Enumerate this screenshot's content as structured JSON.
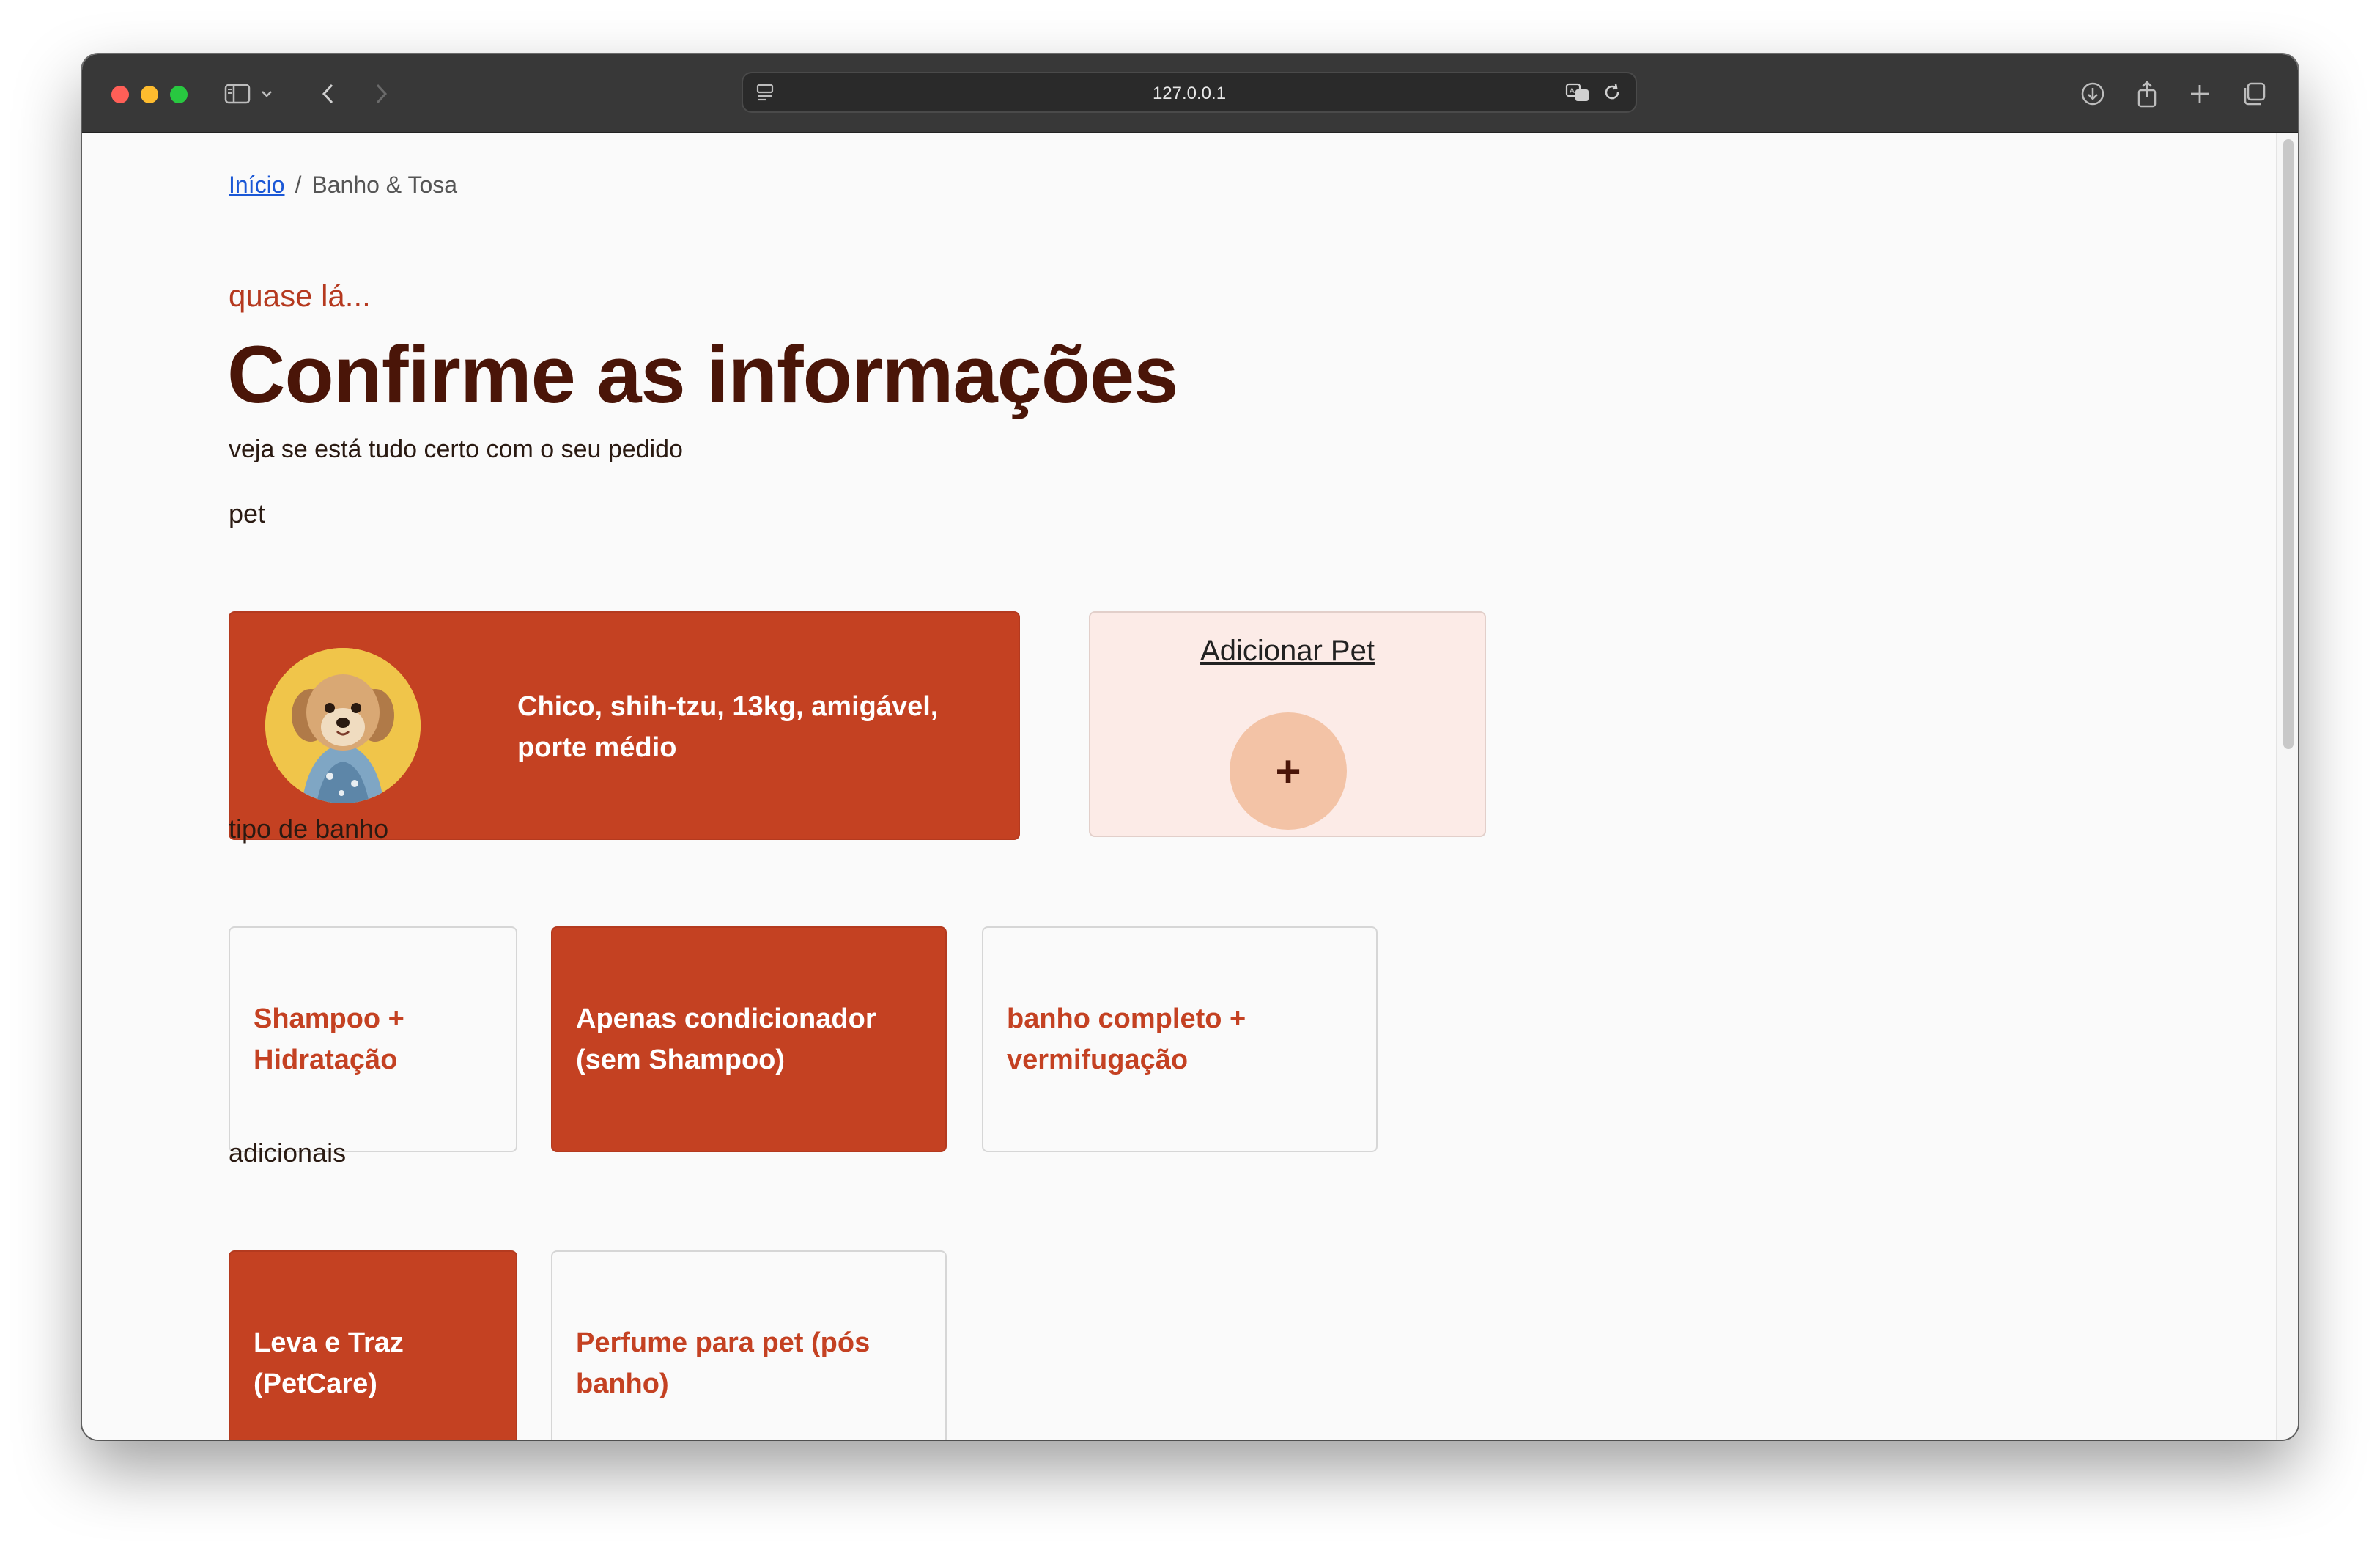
{
  "browser": {
    "url": "127.0.0.1"
  },
  "breadcrumb": {
    "home": "Início",
    "separator": "/",
    "current": "Banho & Tosa"
  },
  "header": {
    "eyebrow": "quase lá...",
    "title": "Confirme as informações",
    "subtitle": "veja se está tudo certo com o seu pedido"
  },
  "pet_section": {
    "label": "pet",
    "selected_pet": {
      "description": "Chico, shih-tzu, 13kg, amigável, porte médio"
    },
    "add_pet": {
      "label": "Adicionar Pet",
      "icon": "+"
    }
  },
  "bath_section": {
    "label": "tipo de banho",
    "options": [
      {
        "label": "Shampoo + Hidratação",
        "selected": false
      },
      {
        "label": "Apenas condicionador (sem Shampoo)",
        "selected": true
      },
      {
        "label": "banho completo + vermifugação",
        "selected": false
      }
    ]
  },
  "extras_section": {
    "label": "adicionais",
    "options": [
      {
        "label": "Leva e Traz (PetCare)",
        "selected": true
      },
      {
        "label": "Perfume para pet (pós banho)",
        "selected": false
      }
    ]
  },
  "colors": {
    "accent": "#c44122",
    "title": "#4a1508",
    "add_card_bg": "#fcebe7",
    "add_circle": "#f3c3a6"
  }
}
